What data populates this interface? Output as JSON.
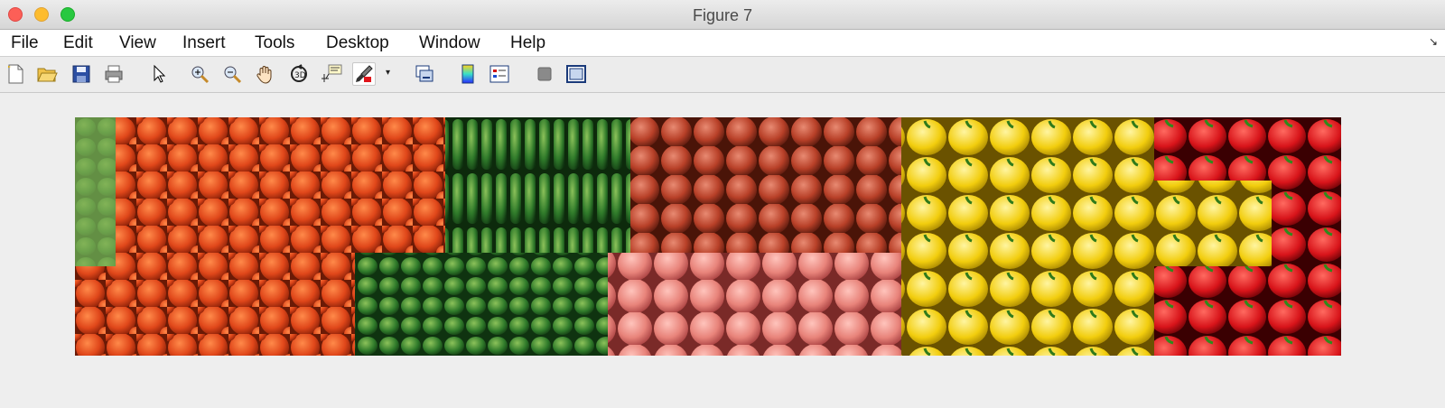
{
  "window": {
    "title": "Figure 7"
  },
  "menu": [
    "File",
    "Edit",
    "View",
    "Insert",
    "Tools",
    "Desktop",
    "Window",
    "Help"
  ],
  "toolbar": {
    "icons": [
      "new-figure-icon",
      "open-file-icon",
      "save-icon",
      "print-icon",
      "edit-plot-arrow-icon",
      "zoom-in-icon",
      "zoom-out-icon",
      "pan-hand-icon",
      "rotate-3d-icon",
      "data-cursor-icon",
      "brush-icon",
      "brush-dropdown-icon",
      "link-plot-icon",
      "insert-colorbar-icon",
      "insert-legend-icon",
      "hide-plot-tools-icon",
      "show-plot-tools-icon"
    ]
  },
  "image": {
    "subject": "vegetables",
    "sections": [
      "orange tomatoes",
      "green cucumbers",
      "red and pink tomatoes",
      "yellow peppers",
      "red peppers"
    ],
    "colors": {
      "orange_tomato": "#e0471a",
      "cucumber": "#2f7a2a",
      "red_tomato": "#c64a34",
      "pink_tomato": "#e8837a",
      "yellow_pepper": "#f2cd0d",
      "red_pepper": "#d8141a"
    }
  }
}
